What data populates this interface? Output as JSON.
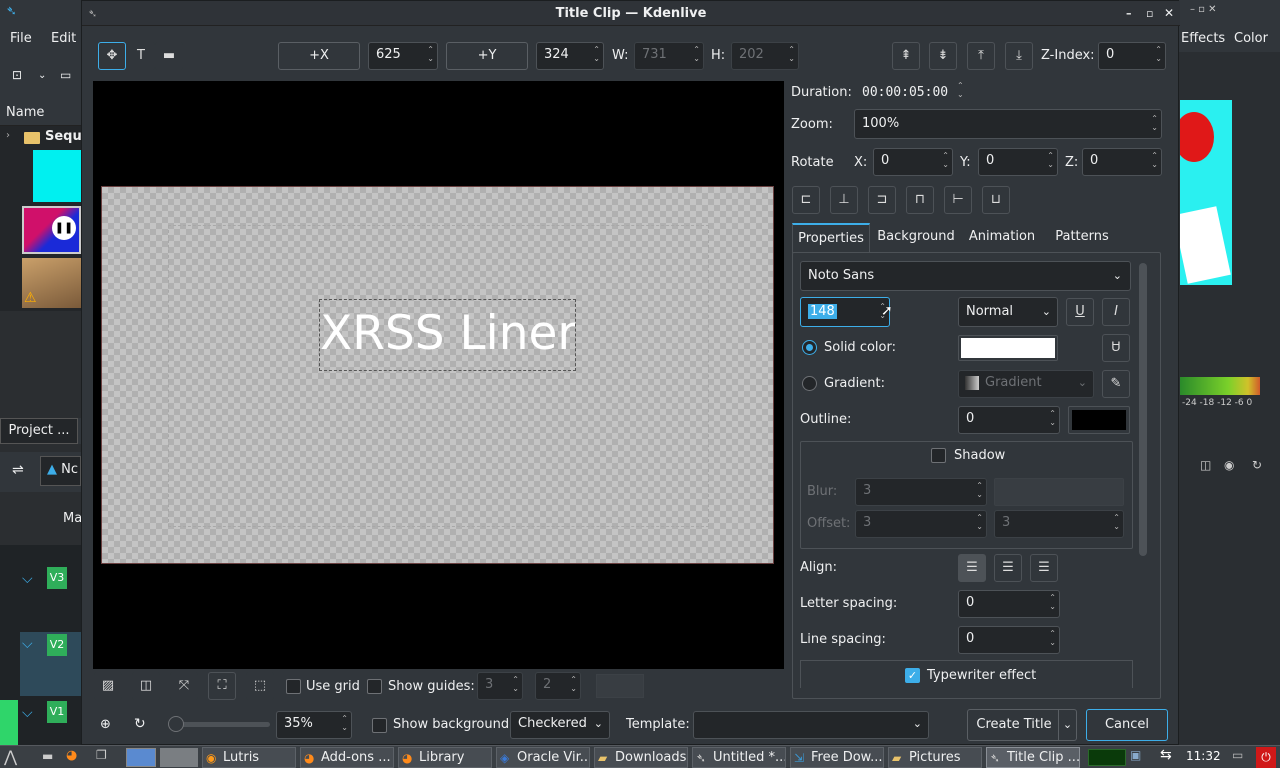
{
  "window": {
    "title": "Title Clip — Kdenlive"
  },
  "background_app": {
    "menu_file": "File",
    "menu_edit": "Edit",
    "menu_effects": "Effects",
    "menu_color": "Color",
    "bin_header": "Name",
    "bin_folder": "Seque",
    "project_tab": "Project ...",
    "track_v3": "V3",
    "track_v2": "V2",
    "track_v1": "V1",
    "ma_label": "Ma",
    "no_label": "Nc",
    "meter_scale": "-24 -18 -12 -6 0"
  },
  "toolbar": {
    "plus_x_label": "+X",
    "x_value": "625",
    "plus_y_label": "+Y",
    "y_value": "324",
    "w_label": "W:",
    "w_value": "731",
    "h_label": "H:",
    "h_value": "202",
    "zindex_label": "Z-Index:",
    "zindex_value": "0"
  },
  "canvas": {
    "text": "XRSS Liner"
  },
  "side": {
    "duration_label": "Duration:",
    "duration_value": "00:00:05:00",
    "zoom_label": "Zoom:",
    "zoom_value": "100%",
    "rotate_label": "Rotate",
    "rx_label": "X:",
    "rx_value": "0",
    "ry_label": "Y:",
    "ry_value": "0",
    "rz_label": "Z:",
    "rz_value": "0"
  },
  "tabs": {
    "properties": "Properties",
    "background": "Background",
    "animation": "Animation",
    "patterns": "Patterns"
  },
  "props": {
    "font": "Noto Sans",
    "font_size": "148",
    "weight": "Normal",
    "solid_color_label": "Solid color:",
    "gradient_label": "Gradient:",
    "gradient_value": "Gradient",
    "outline_label": "Outline:",
    "outline_value": "0",
    "shadow_label": "Shadow",
    "blur_label": "Blur:",
    "blur_value": "3",
    "offset_label": "Offset:",
    "offset_x": "3",
    "offset_y": "3",
    "align_label": "Align:",
    "letter_spacing_label": "Letter spacing:",
    "letter_spacing_value": "0",
    "line_spacing_label": "Line spacing:",
    "line_spacing_value": "0",
    "typewriter_label": "Typewriter effect",
    "colors": {
      "solid": "#ffffff",
      "outline": "#000000",
      "accent": "#3daee9"
    }
  },
  "bottom": {
    "use_grid": "Use grid",
    "show_guides": "Show guides:",
    "guides_a": "3",
    "guides_b": "2",
    "zoom_pct": "35%",
    "show_background": "Show background",
    "bg_style": "Checkered",
    "template_label": "Template:",
    "create_title": "Create Title",
    "cancel": "Cancel"
  },
  "taskbar": {
    "items": [
      "Lutris",
      "Add-ons ...",
      "Library",
      "Oracle Vir...",
      "Downloads",
      "Untitled *...",
      "Free Dow...",
      "Pictures",
      "Title Clip ..."
    ],
    "clock": "11:32"
  }
}
